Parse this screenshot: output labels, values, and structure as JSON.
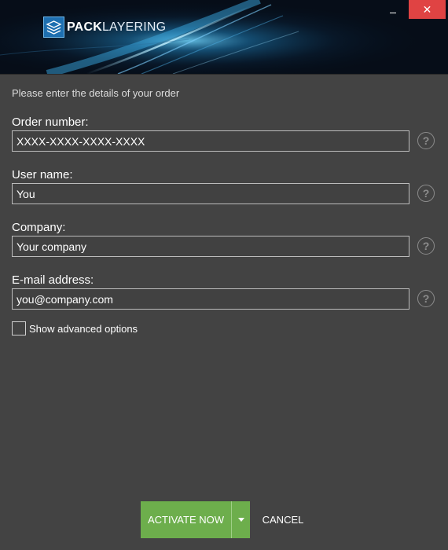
{
  "window": {
    "brand_bold": "PACK",
    "brand_light": "LAYERING",
    "minimize_glyph": "",
    "close_glyph": "✕"
  },
  "intro": "Please enter the details of your order",
  "fields": [
    {
      "label": "Order number:",
      "value": "XXXX-XXXX-XXXX-XXXX"
    },
    {
      "label": "User name:",
      "value": "You"
    },
    {
      "label": "Company:",
      "value": "Your company"
    },
    {
      "label": "E-mail address:",
      "value": "you@company.com"
    }
  ],
  "help_glyph": "?",
  "advanced": {
    "label": "Show advanced options",
    "checked": false
  },
  "buttons": {
    "activate": "ACTIVATE NOW",
    "cancel": "CANCEL"
  },
  "colors": {
    "background": "#434343",
    "accent_green": "#6dae4c",
    "close_red": "#e04343",
    "header_dark": "#050b14"
  },
  "icons": {
    "logo": "stacked-layers-icon",
    "help": "question-circle-icon",
    "dropdown": "caret-down-icon"
  }
}
